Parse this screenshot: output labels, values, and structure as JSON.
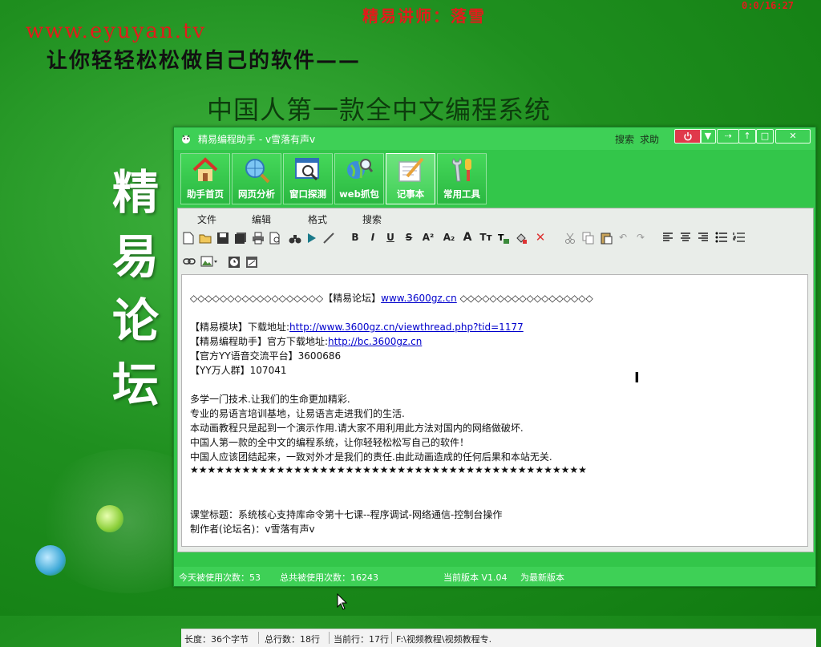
{
  "overlay": {
    "top_title": "精易讲师：落雪",
    "timer": "0:0/16:27",
    "site_url": "www.eyuyan.tv",
    "slogan": "让你轻轻松松做自己的软件——",
    "subtitle": "中国人第一款全中文编程系统",
    "vertical_chars": [
      "精",
      "易",
      "论",
      "坛"
    ]
  },
  "window": {
    "title": "精易编程助手 - v雪落有声v",
    "links": {
      "search": "搜索",
      "help": "求助"
    },
    "toolbar": [
      {
        "label": "助手首页",
        "icon": "home-icon"
      },
      {
        "label": "网页分析",
        "icon": "globe-search-icon"
      },
      {
        "label": "窗口探测",
        "icon": "window-search-icon"
      },
      {
        "label": "web抓包",
        "icon": "globe-magnifier-icon"
      },
      {
        "label": "记事本",
        "icon": "notepad-icon"
      },
      {
        "label": "常用工具",
        "icon": "tools-icon"
      }
    ],
    "menu": [
      "文件",
      "编辑",
      "格式",
      "搜索"
    ],
    "format_buttons": [
      "B",
      "I",
      "U",
      "S",
      "A²",
      "A₂",
      "A",
      "Tт"
    ]
  },
  "document": {
    "forum_left": "◇◇◇◇◇◇◇◇◇◇◇◇◇◇◇◇◇◇【精易论坛】",
    "forum_link": "www.3600gz.cn",
    "forum_right": " ◇◇◇◇◇◇◇◇◇◇◇◇◇◇◇◇◇◇",
    "module_label": "【精易模块】下载地址:",
    "module_link": "http://www.3600gz.cn/viewthread.php?tid=1177",
    "helper_label": "【精易编程助手】官方下载地址:",
    "helper_link": "http://bc.3600gz.cn",
    "yy_platform": "【官方YY语音交流平台】3600686",
    "yy_group": "【YY万人群】107041",
    "line1": "多学一门技术.让我们的生命更加精彩.",
    "line2": "专业的易语言培训基地，让易语言走进我们的生活.",
    "line3": "本动画教程只是起到一个演示作用.请大家不用利用此方法对国内的网络做破坏.",
    "line4": "中国人第一款的全中文的编程系统，让你轻轻松松写自己的软件！",
    "line5": "中国人应该团结起来，一致对外才是我们的责任.由此动画造成的任何后果和本站无关.",
    "stars": "★★★★★★★★★★★★★★★★★★★★★★★★★★★★★★★★★★★★★★★★★★★★★★",
    "lesson": "课堂标题：系统核心支持库命令第十七课--程序调试-网络通信-控制台操作",
    "author": "制作者(论坛名)：v雪落有声v"
  },
  "status": {
    "length": "长度：36个字节",
    "total_lines": "总行数：18行",
    "current_line": "当前行：17行",
    "path": "F:\\视频教程\\视频教程专."
  },
  "bottom": {
    "today": "今天被使用次数：53",
    "total": "总共被使用次数：16243",
    "version": "当前版本 V1.04",
    "latest": "为最新版本"
  }
}
